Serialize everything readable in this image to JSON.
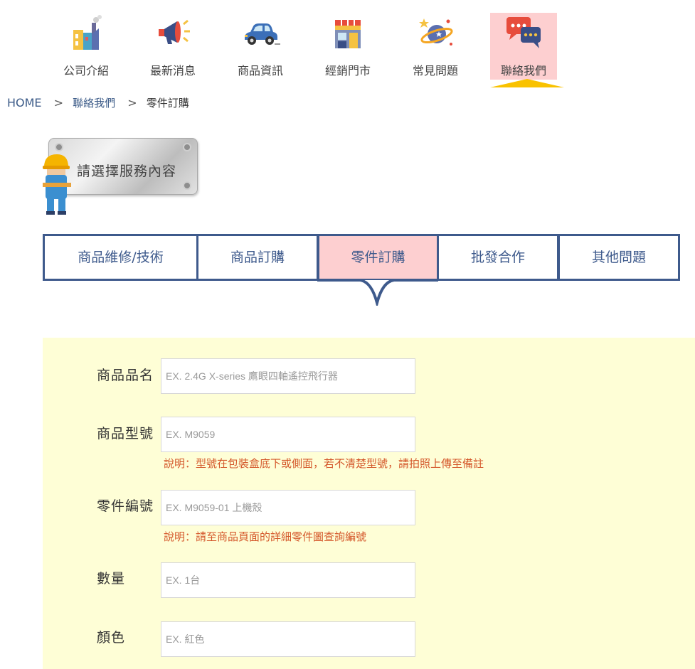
{
  "nav": {
    "items": [
      {
        "label": "公司介紹",
        "icon": "factory-icon"
      },
      {
        "label": "最新消息",
        "icon": "megaphone-icon"
      },
      {
        "label": "商品資訊",
        "icon": "car-icon"
      },
      {
        "label": "經銷門市",
        "icon": "storefront-icon"
      },
      {
        "label": "常見問題",
        "icon": "planet-icon"
      },
      {
        "label": "聯絡我們",
        "icon": "chat-bubbles-icon",
        "active": true
      }
    ]
  },
  "breadcrumb": {
    "home": "HOME",
    "separator": ">",
    "level1": "聯絡我們",
    "current": "零件訂購"
  },
  "sign": {
    "text": "請選擇服務內容"
  },
  "tabs": [
    {
      "label": "商品維修/技術"
    },
    {
      "label": "商品訂購"
    },
    {
      "label": "零件訂購",
      "active": true
    },
    {
      "label": "批發合作"
    },
    {
      "label": "其他問題"
    }
  ],
  "form": {
    "fields": [
      {
        "label": "商品品名",
        "placeholder": "EX. 2.4G X-series 鷹眼四軸遙控飛行器",
        "value": ""
      },
      {
        "label": "商品型號",
        "placeholder": "EX. M9059",
        "value": "",
        "note": "說明：型號在包裝盒底下或側面，若不清楚型號，請拍照上傳至備註"
      },
      {
        "label": "零件編號",
        "placeholder": "EX. M9059-01 上機殼",
        "value": "",
        "note": "說明：請至商品頁面的詳細零件圖查詢編號"
      },
      {
        "label": "數量",
        "placeholder": "EX. 1台",
        "value": ""
      },
      {
        "label": "顏色",
        "placeholder": "EX. 紅色",
        "value": ""
      }
    ]
  },
  "colors": {
    "accent_navy": "#3e5a8c",
    "active_pink": "#fdcfd0",
    "pointer_yellow": "#f9c200",
    "form_bg": "#fefed6",
    "note_red": "#d4572a"
  }
}
